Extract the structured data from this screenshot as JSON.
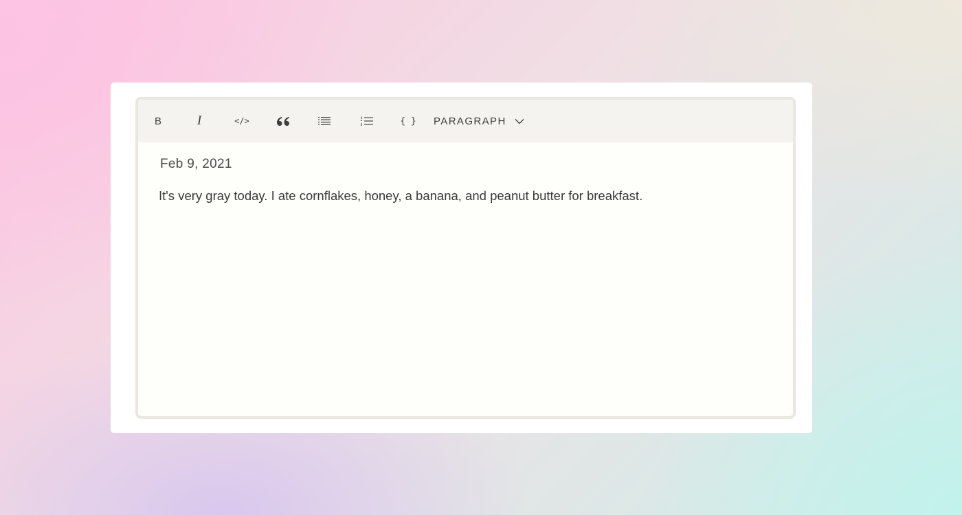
{
  "toolbar": {
    "bold_label": "B",
    "italic_label": "I",
    "code_label": "</>",
    "code_block_label": "{ }",
    "block_type": {
      "selected": "PARAGRAPH"
    },
    "icons": {
      "quote": "quote-icon",
      "bulleted_list": "bulleted-list-icon",
      "numbered_list": "numbered-list-icon",
      "dropdown": "chevron-down-icon"
    }
  },
  "document": {
    "date": "Feb 9, 2021",
    "paragraph": "It's very gray today. I ate cornflakes, honey, a banana, and peanut butter for breakfast."
  },
  "colors": {
    "card": "#ffffff",
    "editor_border": "#e9e7de",
    "toolbar_bg": "#f4f3ef",
    "editor_bg": "#fefefa"
  }
}
